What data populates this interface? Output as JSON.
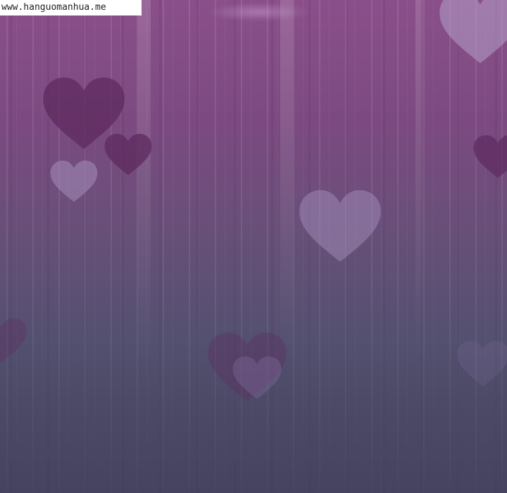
{
  "watermark": {
    "text": "www.hanguomanhua.me"
  },
  "background": {
    "top_color": "#8a4f8a",
    "bottom_color": "#454360",
    "stripe_color": "#ffffff"
  },
  "hearts": [
    {
      "name": "heart-top-right",
      "color": "#b3a0c8",
      "opacity": 0.55
    },
    {
      "name": "heart-large-dark",
      "color": "#5e2a5e",
      "opacity": 0.75
    },
    {
      "name": "heart-small-dark",
      "color": "#5e2a5e",
      "opacity": 0.75
    },
    {
      "name": "heart-small-light",
      "color": "#a894c0",
      "opacity": 0.5
    },
    {
      "name": "heart-center-light",
      "color": "#a894c0",
      "opacity": 0.45
    },
    {
      "name": "heart-right-edge",
      "color": "#5e2a5e",
      "opacity": 0.7
    },
    {
      "name": "heart-left-edge",
      "color": "#5e2a5e",
      "opacity": 0.35
    },
    {
      "name": "heart-bottom-dark",
      "color": "#5e2a5e",
      "opacity": 0.35
    },
    {
      "name": "heart-bottom-light",
      "color": "#8a78a8",
      "opacity": 0.3
    },
    {
      "name": "heart-bottom-right-faint",
      "color": "#8a78a8",
      "opacity": 0.18
    }
  ]
}
